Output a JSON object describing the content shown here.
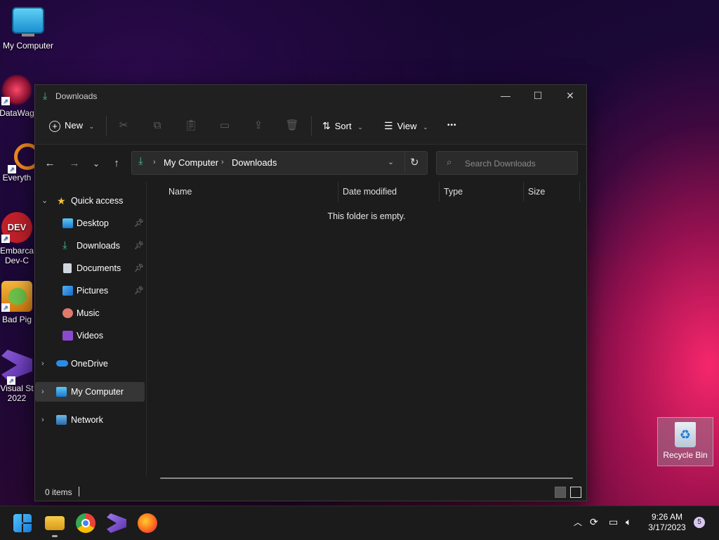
{
  "desktop": {
    "icons": [
      {
        "label": "My Computer"
      },
      {
        "label": "DataWag"
      },
      {
        "label": "Everyth"
      },
      {
        "label": "Embarca\nDev-C"
      },
      {
        "label": "Bad Pig"
      },
      {
        "label": "Visual St\n2022"
      }
    ],
    "recycle_bin": "Recycle Bin"
  },
  "window": {
    "title": "Downloads",
    "controls": {
      "minimize": "—",
      "maximize": "☐",
      "close": "✕"
    },
    "toolbar": {
      "new_label": "New",
      "sort_label": "Sort",
      "view_label": "View",
      "more_label": "•••"
    },
    "address": {
      "segments": [
        "My Computer",
        "Downloads"
      ]
    },
    "search": {
      "placeholder": "Search Downloads"
    },
    "sidebar": {
      "quick_access": "Quick access",
      "items": [
        {
          "label": "Desktop",
          "pinned": true
        },
        {
          "label": "Downloads",
          "pinned": true
        },
        {
          "label": "Documents",
          "pinned": true
        },
        {
          "label": "Pictures",
          "pinned": true
        },
        {
          "label": "Music",
          "pinned": false
        },
        {
          "label": "Videos",
          "pinned": false
        }
      ],
      "onedrive": "OneDrive",
      "my_computer": "My Computer",
      "network": "Network"
    },
    "columns": [
      "Name",
      "Date modified",
      "Type",
      "Size"
    ],
    "empty_message": "This folder is empty.",
    "status": "0 items"
  },
  "taskbar": {
    "time": "9:26 AM",
    "date": "3/17/2023",
    "notification_count": "5"
  },
  "colors": {
    "accent_green": "#3fc48a",
    "folder_yellow": "#f2c037",
    "onedrive_blue": "#2b8ce6"
  }
}
